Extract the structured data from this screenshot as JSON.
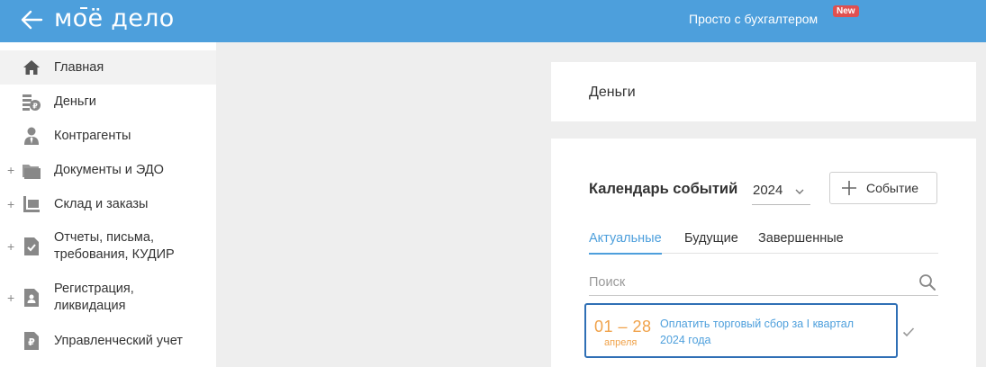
{
  "header": {
    "logo": "моё дело",
    "promo_text": "Просто с бухгалтером",
    "promo_badge": "New"
  },
  "sidebar": {
    "items": [
      {
        "label": "Главная",
        "icon": "home-icon",
        "active": true,
        "expandable": false
      },
      {
        "label": "Деньги",
        "icon": "money-coins-icon",
        "active": false,
        "expandable": false
      },
      {
        "label": "Контрагенты",
        "icon": "counterparty-person-icon",
        "active": false,
        "expandable": false
      },
      {
        "label": "Документы и ЭДО",
        "icon": "folder-icon",
        "active": false,
        "expandable": true
      },
      {
        "label": "Склад и заказы",
        "icon": "warehouse-cart-icon",
        "active": false,
        "expandable": true
      },
      {
        "label": "Отчеты, письма, требования, КУДИР",
        "label_lines": [
          "Отчеты, письма,",
          "требования, КУДИР"
        ],
        "icon": "report-check-icon",
        "active": false,
        "expandable": true
      },
      {
        "label": "Регистрация, ликвидация",
        "label_lines": [
          "Регистрация,",
          "ликвидация"
        ],
        "icon": "registration-doc-icon",
        "active": false,
        "expandable": true
      },
      {
        "label": "Управленческий учет",
        "icon": "ruble-doc-icon",
        "active": false,
        "expandable": false
      }
    ]
  },
  "money_card": {
    "title": "Деньги"
  },
  "calendar": {
    "title": "Календарь событий",
    "year": "2024",
    "add_button_label": "Событие",
    "tabs": [
      {
        "label": "Актуальные",
        "active": true
      },
      {
        "label": "Будущие",
        "active": false
      },
      {
        "label": "Завершенные",
        "active": false
      }
    ],
    "search_placeholder": "Поиск",
    "events": [
      {
        "date_range": "01 – 28",
        "month": "апреля",
        "text": "Оплатить торговый сбор за I квартал 2024 года",
        "text_lines": [
          "Оплатить торговый сбор за I квартал",
          "2024 года"
        ]
      }
    ]
  },
  "colors": {
    "header_bg": "#4d9fdc",
    "accent": "#4d9fdc",
    "event_date": "#f0a24a",
    "selected_border": "#2f6fb5",
    "badge_bg": "#e05050"
  }
}
